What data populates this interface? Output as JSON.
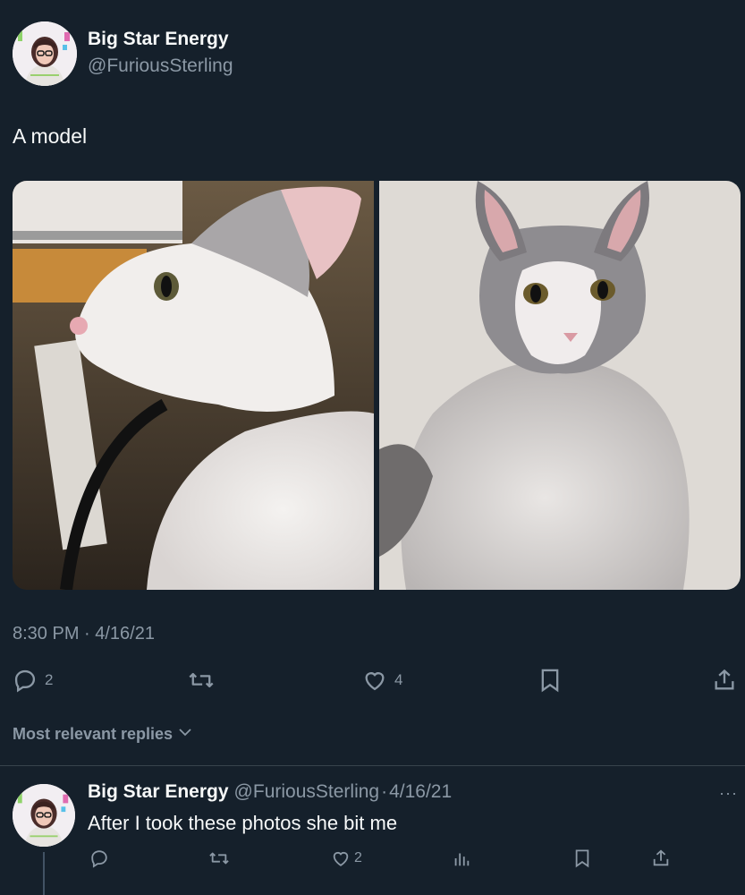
{
  "tweet": {
    "author_name": "Big Star Energy",
    "author_handle": "@FuriousSterling",
    "text": "A model",
    "timestamp": "8:30 PM · 4/16/21",
    "stats": {
      "replies": "2",
      "likes": "4"
    },
    "icons": [
      "reply-icon",
      "retweet-icon",
      "like-icon",
      "bookmark-icon",
      "share-icon"
    ]
  },
  "replies_section": {
    "sort_label": "Most relevant replies"
  },
  "reply": {
    "author_name": "Big Star Energy",
    "author_handle": "@FuriousSterling",
    "separator": "·",
    "date": "4/16/21",
    "text": "After I took these photos she bit me",
    "more_label": "···",
    "stats": {
      "likes": "2"
    },
    "icons": [
      "reply-icon",
      "retweet-icon",
      "like-icon",
      "views-icon",
      "bookmark-icon",
      "share-icon"
    ]
  },
  "colors": {
    "background": "#15202b",
    "text_primary": "#f7f9f9",
    "text_secondary": "#8b98a5",
    "divider": "#38444d"
  }
}
